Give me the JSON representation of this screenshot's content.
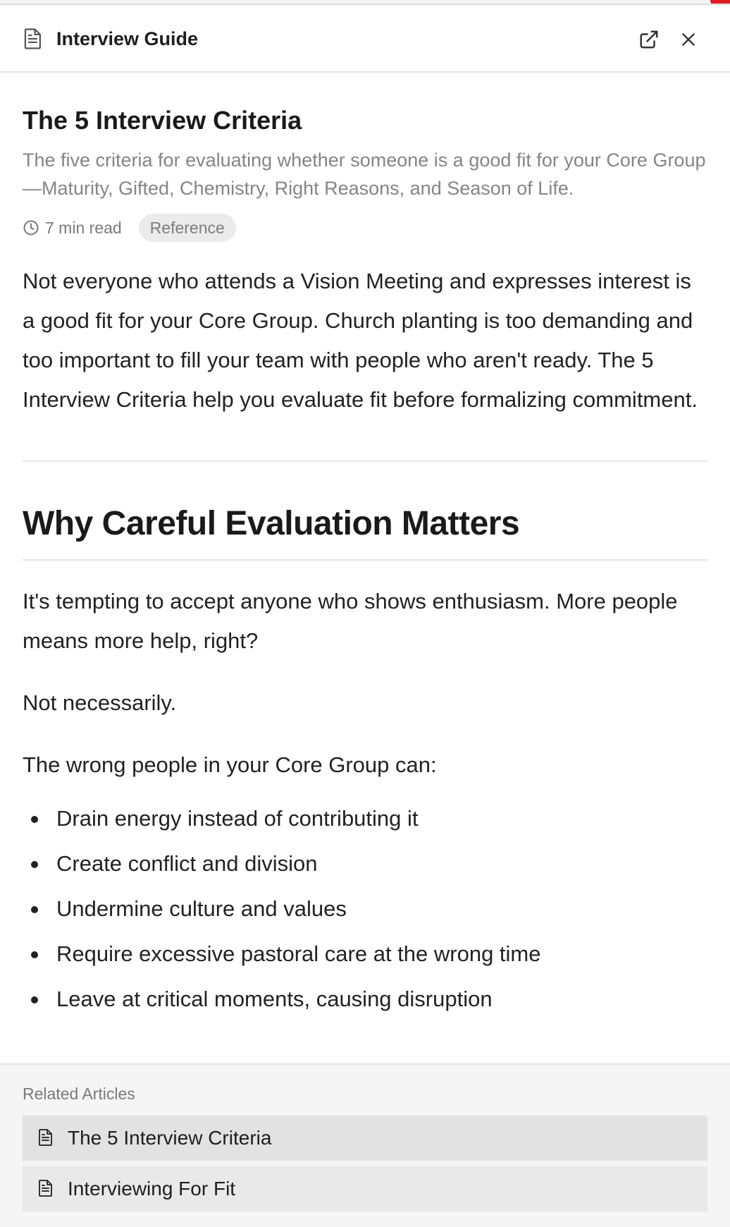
{
  "header": {
    "title": "Interview Guide",
    "icon": "document-icon",
    "open_external_icon": "external-link-icon",
    "close_icon": "close-icon"
  },
  "article": {
    "title": "The 5 Interview Criteria",
    "summary": "The five criteria for evaluating whether someone is a good fit for your Core Group—Maturity, Gifted, Chemistry, Right Reasons, and Season of Life.",
    "read_time": "7 min read",
    "tag": "Reference",
    "intro": "Not everyone who attends a Vision Meeting and expresses interest is a good fit for your Core Group. Church planting is too demanding and too important to fill your team with people who aren't ready. The 5 Interview Criteria help you evaluate fit before formalizing commitment.",
    "section_heading": "Why Careful Evaluation Matters",
    "paragraphs": [
      "It's tempting to accept anyone who shows enthusiasm. More people means more help, right?",
      "Not necessarily.",
      "The wrong people in your Core Group can:"
    ],
    "bullets": [
      "Drain energy instead of contributing it",
      "Create conflict and division",
      "Undermine culture and values",
      "Require excessive pastoral care at the wrong time",
      "Leave at critical moments, causing disruption"
    ]
  },
  "related": {
    "label": "Related Articles",
    "items": [
      {
        "label": "The 5 Interview Criteria"
      },
      {
        "label": "Interviewing For Fit"
      }
    ]
  },
  "colors": {
    "accent_badge": "#e01b24",
    "text_primary": "#1c1c1c",
    "text_muted": "#858585"
  }
}
